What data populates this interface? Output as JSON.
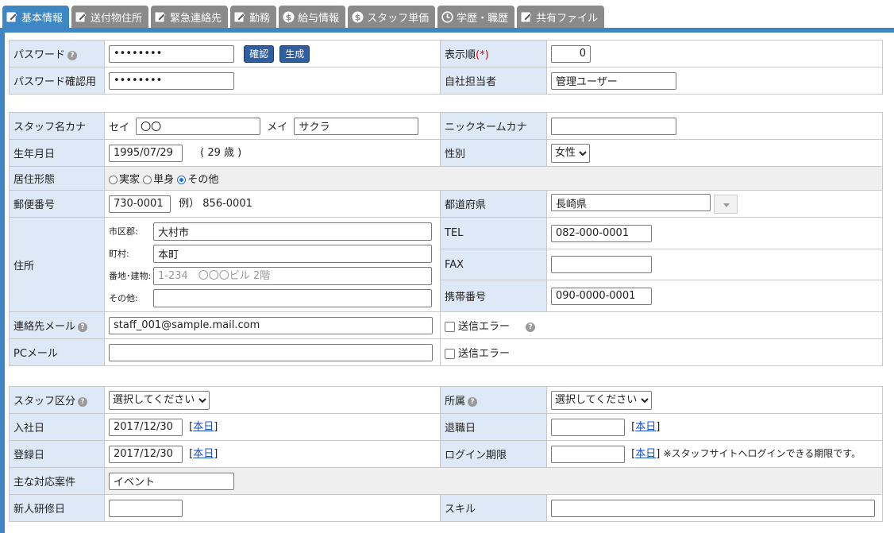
{
  "tabs": [
    {
      "label": "基本情報",
      "icon": "edit-icon",
      "active": true
    },
    {
      "label": "送付物住所",
      "icon": "edit-icon"
    },
    {
      "label": "緊急連絡先",
      "icon": "edit-icon"
    },
    {
      "label": "勤務",
      "icon": "edit-icon"
    },
    {
      "label": "給与情報",
      "icon": "dollar-icon"
    },
    {
      "label": "スタッフ単価",
      "icon": "dollar-icon"
    },
    {
      "label": "学歴・職歴",
      "icon": "clock-icon"
    },
    {
      "label": "共有ファイル",
      "icon": "edit-icon"
    }
  ],
  "section1": {
    "password_label": "パスワード",
    "password_value": "••••••••",
    "confirm_btn": "確認",
    "generate_btn": "生成",
    "order_label": "表示順",
    "required_mark": "(*)",
    "order_value": "0",
    "password_confirm_label": "パスワード確認用",
    "password_confirm_value": "••••••••",
    "manager_label": "自社担当者",
    "manager_value": "管理ユーザー"
  },
  "section2": {
    "name_kana_label": "スタッフ名カナ",
    "sei_label": "セイ",
    "sei_value": "〇〇",
    "mei_label": "メイ",
    "mei_value": "サクラ",
    "nickname_label": "ニックネームカナ",
    "nickname_value": "",
    "birthday_label": "生年月日",
    "birthday_value": "1995/07/29",
    "age_text": "( 29 歳 )",
    "gender_label": "性別",
    "gender_value": "女性",
    "residence_label": "居住形態",
    "residence_options": [
      "実家",
      "単身",
      "その他"
    ],
    "residence_selected": "その他",
    "postal_label": "郵便番号",
    "postal_value": "730-0001",
    "postal_example": "例） 856-0001",
    "pref_label": "都道府県",
    "pref_value": "長崎県",
    "address_label": "住所",
    "city_label": "市区郡:",
    "city_value": "大村市",
    "town_label": "町村:",
    "town_value": "本町",
    "street_label": "番地･建物:",
    "street_placeholder": "1-234　〇〇〇ビル 2階",
    "other_label": "その他:",
    "other_value": "",
    "tel_label": "TEL",
    "tel_value": "082-000-0001",
    "fax_label": "FAX",
    "fax_value": "",
    "mobile_label": "携帯番号",
    "mobile_value": "090-0000-0001",
    "email_label": "連絡先メール",
    "email_value": "staff_001@sample.mail.com",
    "send_error_label": "送信エラー",
    "pcmail_label": "PCメール",
    "pcmail_value": ""
  },
  "section3": {
    "staff_type_label": "スタッフ区分",
    "staff_type_value": "選択してください",
    "affiliation_label": "所属",
    "affiliation_value": "選択してください",
    "hire_label": "入社日",
    "hire_value": "2017/12/30",
    "today_link": "本日",
    "retire_label": "退職日",
    "retire_value": "",
    "register_label": "登録日",
    "register_value": "2017/12/30",
    "login_limit_label": "ログイン期限",
    "login_limit_value": "",
    "login_limit_note": "※スタッフサイトへログインできる期限です。",
    "main_case_label": "主な対応案件",
    "main_case_value": "イベント",
    "training_label": "新人研修日",
    "training_value": "",
    "skill_label": "スキル",
    "skill_value": ""
  }
}
